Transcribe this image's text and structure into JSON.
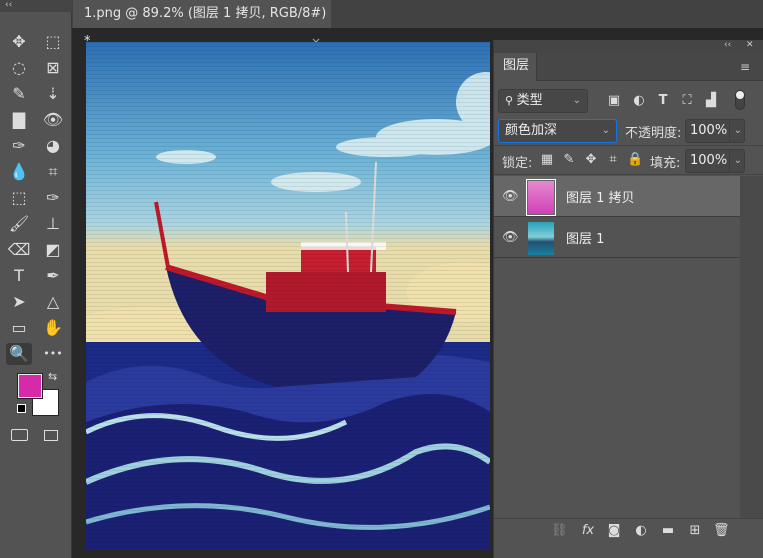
{
  "document_tab": {
    "title": "1.png @ 89.2% (图层 1 拷贝, RGB/8#) *",
    "close": "×"
  },
  "toolbar": {
    "collapse": "‹‹",
    "tools": [
      {
        "name": "move-tool",
        "glyph": "✥"
      },
      {
        "name": "rectangular-marquee-tool",
        "glyph": "⬚"
      },
      {
        "name": "lasso-tool",
        "glyph": "◌"
      },
      {
        "name": "frame-tool",
        "glyph": "⊠"
      },
      {
        "name": "quick-selection-tool",
        "glyph": "✎"
      },
      {
        "name": "perspective-crop-tool",
        "glyph": "⇣"
      },
      {
        "name": "gradient-tool",
        "glyph": "▇"
      },
      {
        "name": "red-eye-tool",
        "glyph": "👁"
      },
      {
        "name": "eyedropper-tool",
        "glyph": "✑"
      },
      {
        "name": "healing-tool",
        "glyph": "◕"
      },
      {
        "name": "blur-tool",
        "glyph": "💧"
      },
      {
        "name": "crop-tool",
        "glyph": "⌗"
      },
      {
        "name": "object-selection-tool",
        "glyph": "⬚"
      },
      {
        "name": "color-sampler-tool",
        "glyph": "✑"
      },
      {
        "name": "brush-tool",
        "glyph": "🖌"
      },
      {
        "name": "stamp-tool",
        "glyph": "⊥"
      },
      {
        "name": "eraser-tool",
        "glyph": "⌫"
      },
      {
        "name": "paint-bucket-tool",
        "glyph": "◩"
      },
      {
        "name": "type-tool",
        "glyph": "T"
      },
      {
        "name": "pen-tool",
        "glyph": "✒"
      },
      {
        "name": "path-selection-tool",
        "glyph": "➤"
      },
      {
        "name": "triangle-tool",
        "glyph": "△"
      },
      {
        "name": "rectangle-tool",
        "glyph": "▭"
      },
      {
        "name": "hand-tool",
        "glyph": "✋"
      },
      {
        "name": "zoom-tool",
        "glyph": "🔍"
      },
      {
        "name": "more-tools",
        "glyph": "•••"
      }
    ],
    "foreground_color": "#d62aa8",
    "background_color": "#ffffff"
  },
  "layers_panel": {
    "collapse": "‹‹",
    "close": "✕",
    "tab_label": "图层",
    "filter_label": "类型",
    "blend_mode": "颜色加深",
    "opacity_label": "不透明度:",
    "opacity_value": "100%",
    "lock_label": "锁定:",
    "fill_label": "填充:",
    "fill_value": "100%",
    "layers": [
      {
        "name": "图层 1 拷贝",
        "selected": true
      },
      {
        "name": "图层 1",
        "selected": false
      }
    ],
    "accent_color": "#1473e6"
  }
}
